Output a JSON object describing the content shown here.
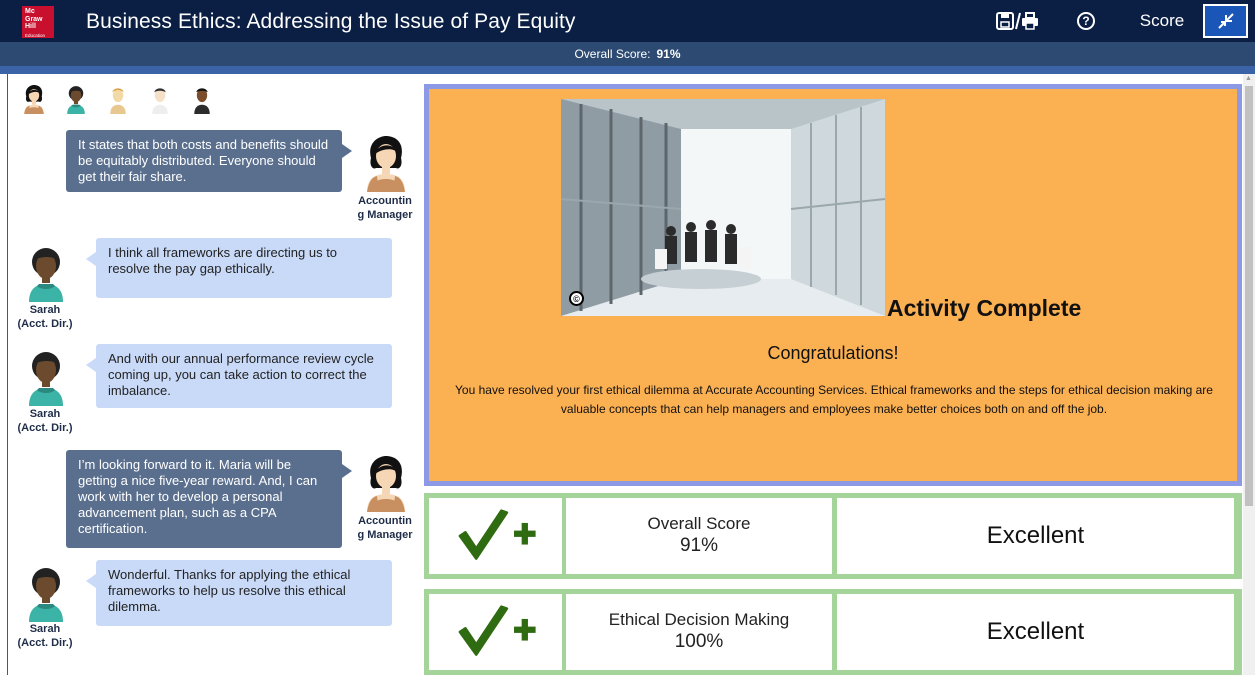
{
  "header": {
    "logo_lines": [
      "Mc",
      "Graw",
      "Hill",
      "Education"
    ],
    "title": "Business Ethics: Addressing the Issue of Pay Equity",
    "save_print_icon": "save-print-icon",
    "help_icon": "help-icon",
    "help_glyph": "?",
    "score_label": "Score",
    "collapse_icon": "collapse-icon"
  },
  "score_bar": {
    "label": "Overall Score:",
    "value": "91%"
  },
  "chat": {
    "messages": [
      {
        "side": "right",
        "text": "It states that both costs and benefits should be equitably distributed. Everyone should get their fair share.",
        "speaker_line1": "Accountin",
        "speaker_line2": "g Manager"
      },
      {
        "side": "left",
        "text": "I think all frameworks are directing us to resolve the pay gap ethically.",
        "speaker_line1": "Sarah",
        "speaker_line2": "(Acct. Dir.)"
      },
      {
        "side": "left",
        "text": "And with our annual performance review cycle coming up, you can take action to correct the imbalance.",
        "speaker_line1": "Sarah",
        "speaker_line2": "(Acct. Dir.)"
      },
      {
        "side": "right",
        "text": "I’m looking forward to it.  Maria will be getting a nice five-year reward.  And, I can work with her to develop a personal advancement plan, such as a CPA certification.",
        "speaker_line1": "Accountin",
        "speaker_line2": "g Manager"
      },
      {
        "side": "left",
        "text": "Wonderful.  Thanks for applying the ethical frameworks to help us resolve this ethical dilemma.",
        "speaker_line1": "Sarah",
        "speaker_line2": "(Acct. Dir.)"
      }
    ]
  },
  "activity": {
    "copyright_symbol": "©",
    "title": "Activity Complete",
    "congrats": "Congratulations!",
    "body": "You have resolved your first ethical dilemma at Accurate Accounting Services. Ethical frameworks and the steps for ethical decision making are valuable concepts that can help managers and employees make better choices both on and off the job."
  },
  "results": [
    {
      "icon": "checkmark-plus-icon",
      "label": "Overall Score",
      "value": "91%",
      "rating": "Excellent"
    },
    {
      "icon": "checkmark-plus-icon",
      "label": "Ethical Decision Making",
      "value": "100%",
      "rating": "Excellent"
    }
  ],
  "colors": {
    "header_bg": "#0b1f44",
    "score_bar_bg": "#2d4a72",
    "card_orange": "#fbb052",
    "card_border": "#8c9ae6",
    "result_green": "#a5d49b",
    "check_green": "#2f6b10"
  }
}
